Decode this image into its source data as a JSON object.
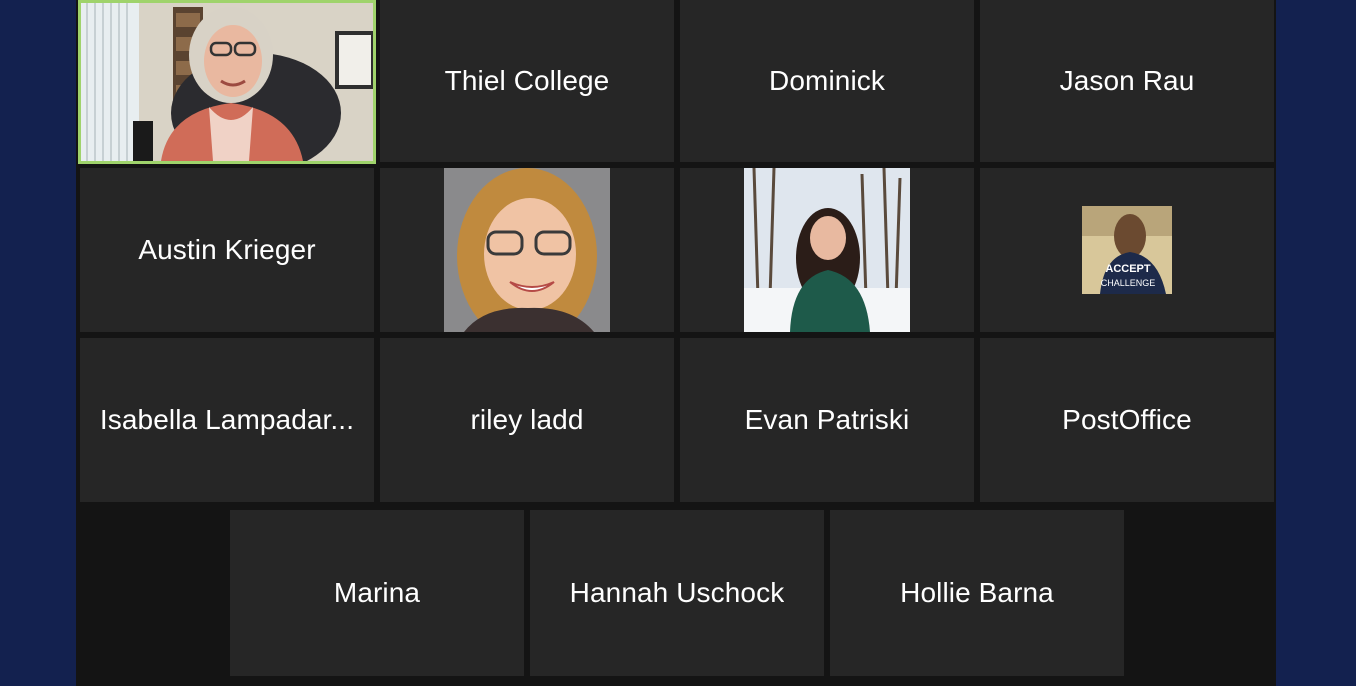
{
  "meeting": {
    "view": "gallery",
    "active_speaker_color": "#9fd36b",
    "participants": [
      {
        "id": "speaker-video",
        "label": "",
        "type": "video",
        "active_speaker": true
      },
      {
        "id": "thiel-college",
        "label": "Thiel College",
        "type": "name"
      },
      {
        "id": "dominick",
        "label": "Dominick",
        "type": "name"
      },
      {
        "id": "jason-rau",
        "label": "Jason Rau",
        "type": "name"
      },
      {
        "id": "austin-krieger",
        "label": "Austin Krieger",
        "type": "name"
      },
      {
        "id": "participant-photo-blonde",
        "label": "",
        "type": "photo"
      },
      {
        "id": "participant-photo-snow",
        "label": "",
        "type": "photo"
      },
      {
        "id": "participant-photo-small",
        "label": "",
        "type": "photo"
      },
      {
        "id": "isabella",
        "label": "Isabella Lampadar...",
        "type": "name"
      },
      {
        "id": "riley-ladd",
        "label": "riley ladd",
        "type": "name"
      },
      {
        "id": "evan-patriski",
        "label": "Evan Patriski",
        "type": "name"
      },
      {
        "id": "postoffice",
        "label": "PostOffice",
        "type": "name"
      },
      {
        "id": "marina",
        "label": "Marina",
        "type": "name"
      },
      {
        "id": "hannah-uschock",
        "label": "Hannah Uschock",
        "type": "name"
      },
      {
        "id": "hollie-barna",
        "label": "Hollie Barna",
        "type": "name"
      }
    ],
    "photo_text": "ACCEPT THE CHALLENGE"
  }
}
